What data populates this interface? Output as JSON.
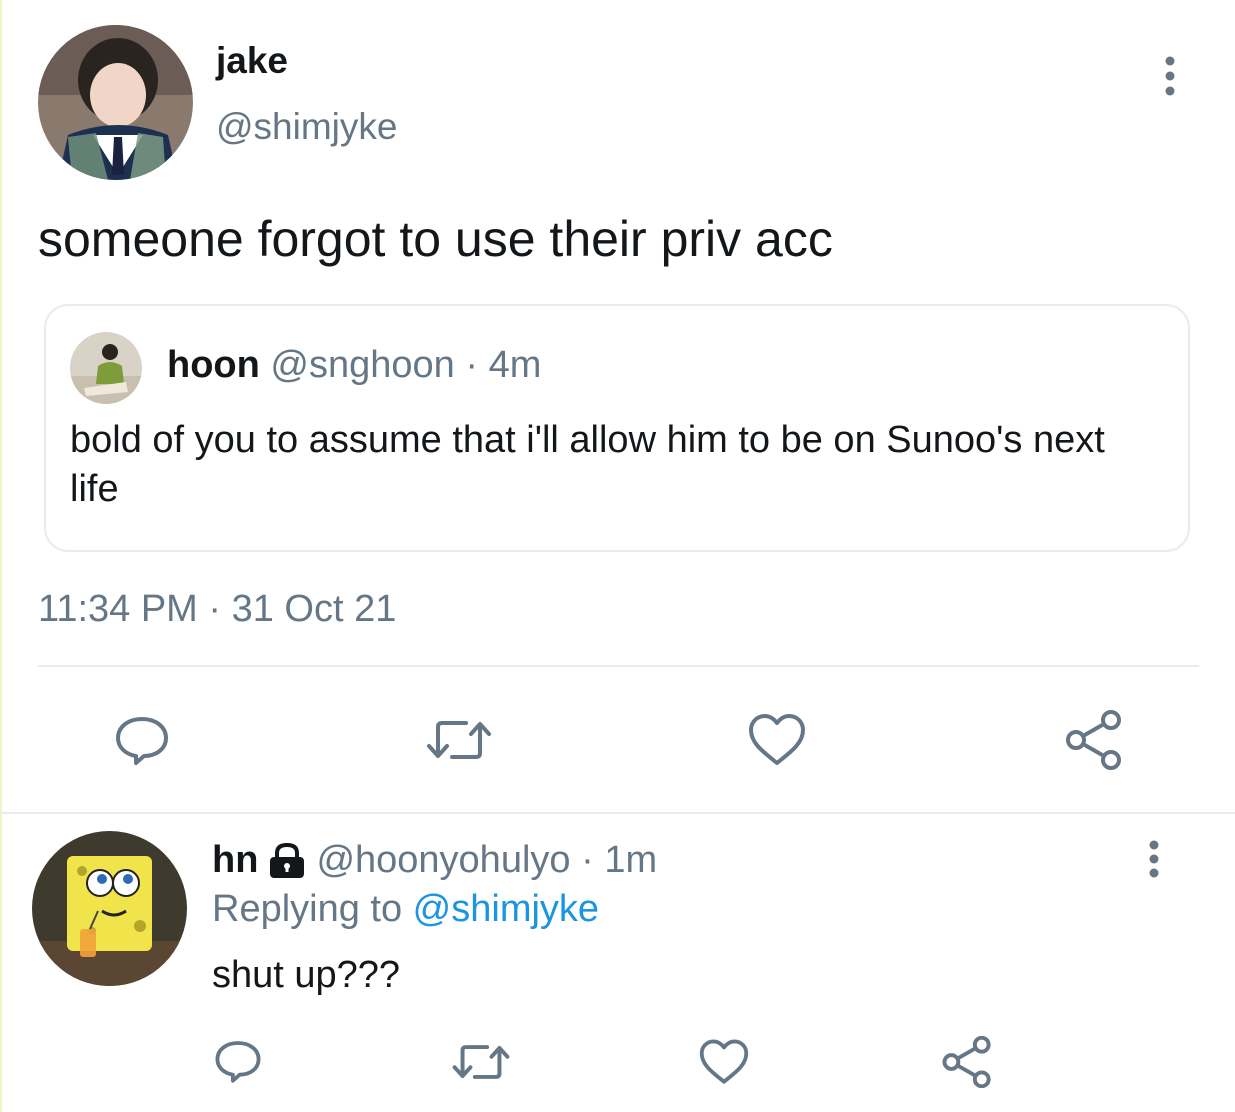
{
  "main_tweet": {
    "display_name": "jake",
    "handle": "@shimjyke",
    "text": "someone forgot to use their priv acc",
    "timestamp": "11:34 PM · 31 Oct 21"
  },
  "quoted_tweet": {
    "display_name": "hoon",
    "handle": "@snghoon",
    "separator": " · ",
    "age": "4m",
    "text": "bold of you to assume that i'll allow him to be on Sunoo's next life"
  },
  "reply_tweet": {
    "display_name": "hn",
    "handle": "@hoonyohulyo",
    "separator": " · ",
    "age": "1m",
    "replying_prefix": "Replying to ",
    "replying_to": "@shimjyke",
    "text": "shut up???"
  },
  "icons": {
    "more": "more-vertical-icon",
    "reply": "reply-icon",
    "retweet": "retweet-icon",
    "like": "heart-icon",
    "share": "share-icon",
    "lock": "lock-icon"
  },
  "colors": {
    "text": "#14171a",
    "muted": "#657786",
    "link": "#1b95e0",
    "divider": "#e6ecf0"
  }
}
